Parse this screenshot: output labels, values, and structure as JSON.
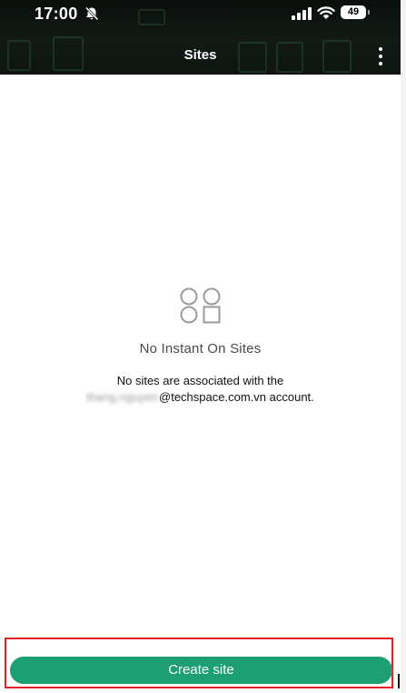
{
  "status_bar": {
    "time": "17:00",
    "battery": "49",
    "icons": [
      "bell-slash-icon",
      "cellular-signal-icon",
      "wifi-icon",
      "battery-icon"
    ]
  },
  "header": {
    "title": "Sites",
    "menu_icon": "more-vertical-icon"
  },
  "empty_state": {
    "icon": "sites-placeholder-icon",
    "title": "No Instant On Sites",
    "message_line1": "No sites are associated with the",
    "email_user_redacted": "thang.nguyen",
    "email_domain": "@techspace.com.vn",
    "message_line2_suffix": "account."
  },
  "actions": {
    "create_label": "Create site"
  },
  "colors": {
    "header_bg": "#0e1511",
    "accent": "#1e9e73",
    "highlight_border": "#e21f26",
    "muted_text": "#4b4b4b"
  }
}
